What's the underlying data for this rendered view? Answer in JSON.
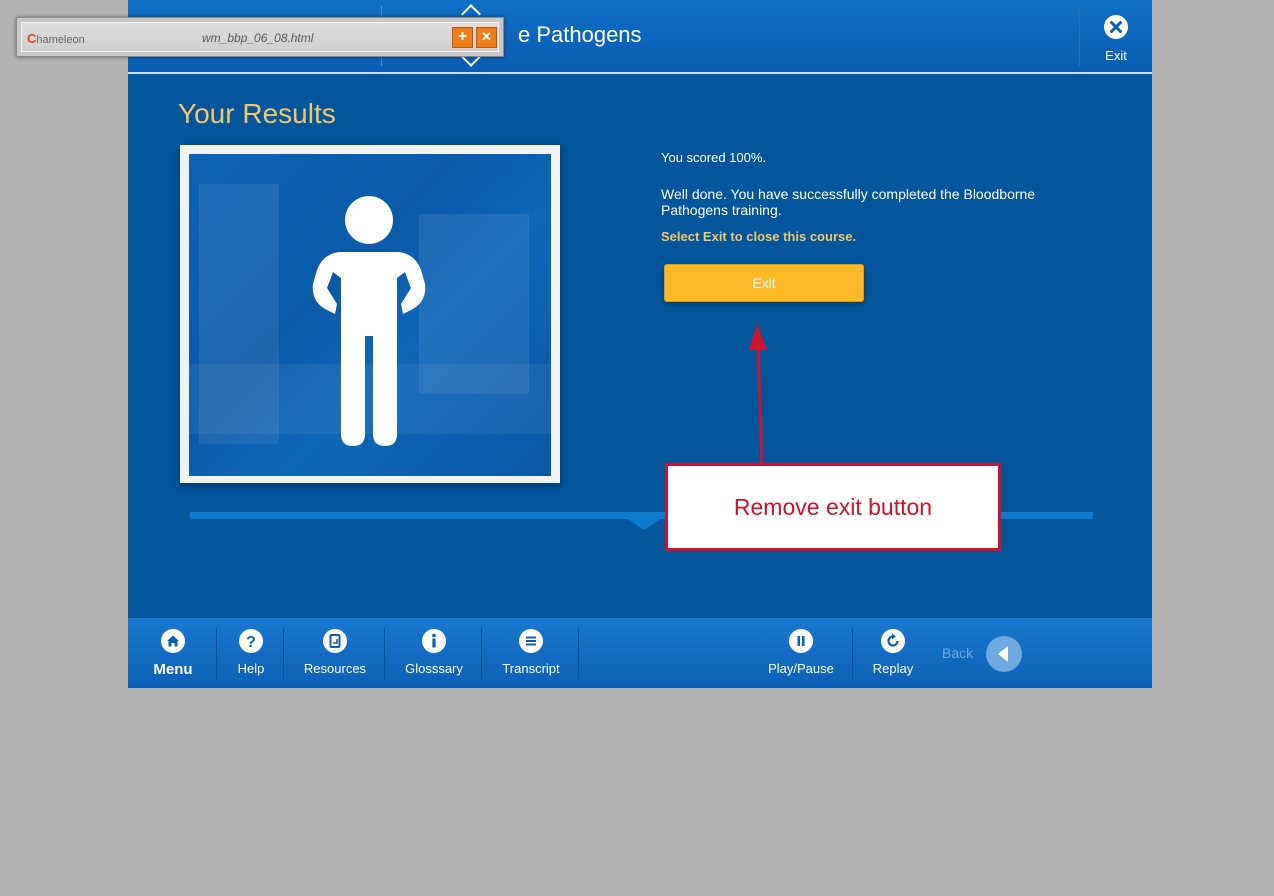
{
  "header": {
    "course_title": "e Pathogens",
    "exit_label": "Exit"
  },
  "chameleon": {
    "logo_text": "hameleon",
    "logo_letter": "C",
    "filename": "wm_bbp_06_08.html",
    "add_glyph": "+",
    "close_glyph": "✕"
  },
  "content": {
    "title": "Your Results",
    "score": "You scored 100%.",
    "message": "Well done.  You have successfully completed the Bloodborne Pathogens training.",
    "instruction": "Select Exit to close this course.",
    "exit_button": "Exit"
  },
  "footer": {
    "menu": "Menu",
    "help": "Help",
    "resources": "Resources",
    "glossary": "Glosssary",
    "transcript": "Transcript",
    "play_pause": "Play/Pause",
    "replay": "Replay",
    "back": "Back"
  },
  "annotation": {
    "text": "Remove exit button",
    "color": "#d0112b"
  },
  "colors": {
    "background": "#b4b4b4",
    "course_blue": "#03559c",
    "accent_yellow": "#f3c668",
    "button_yellow": "#fdb827"
  }
}
